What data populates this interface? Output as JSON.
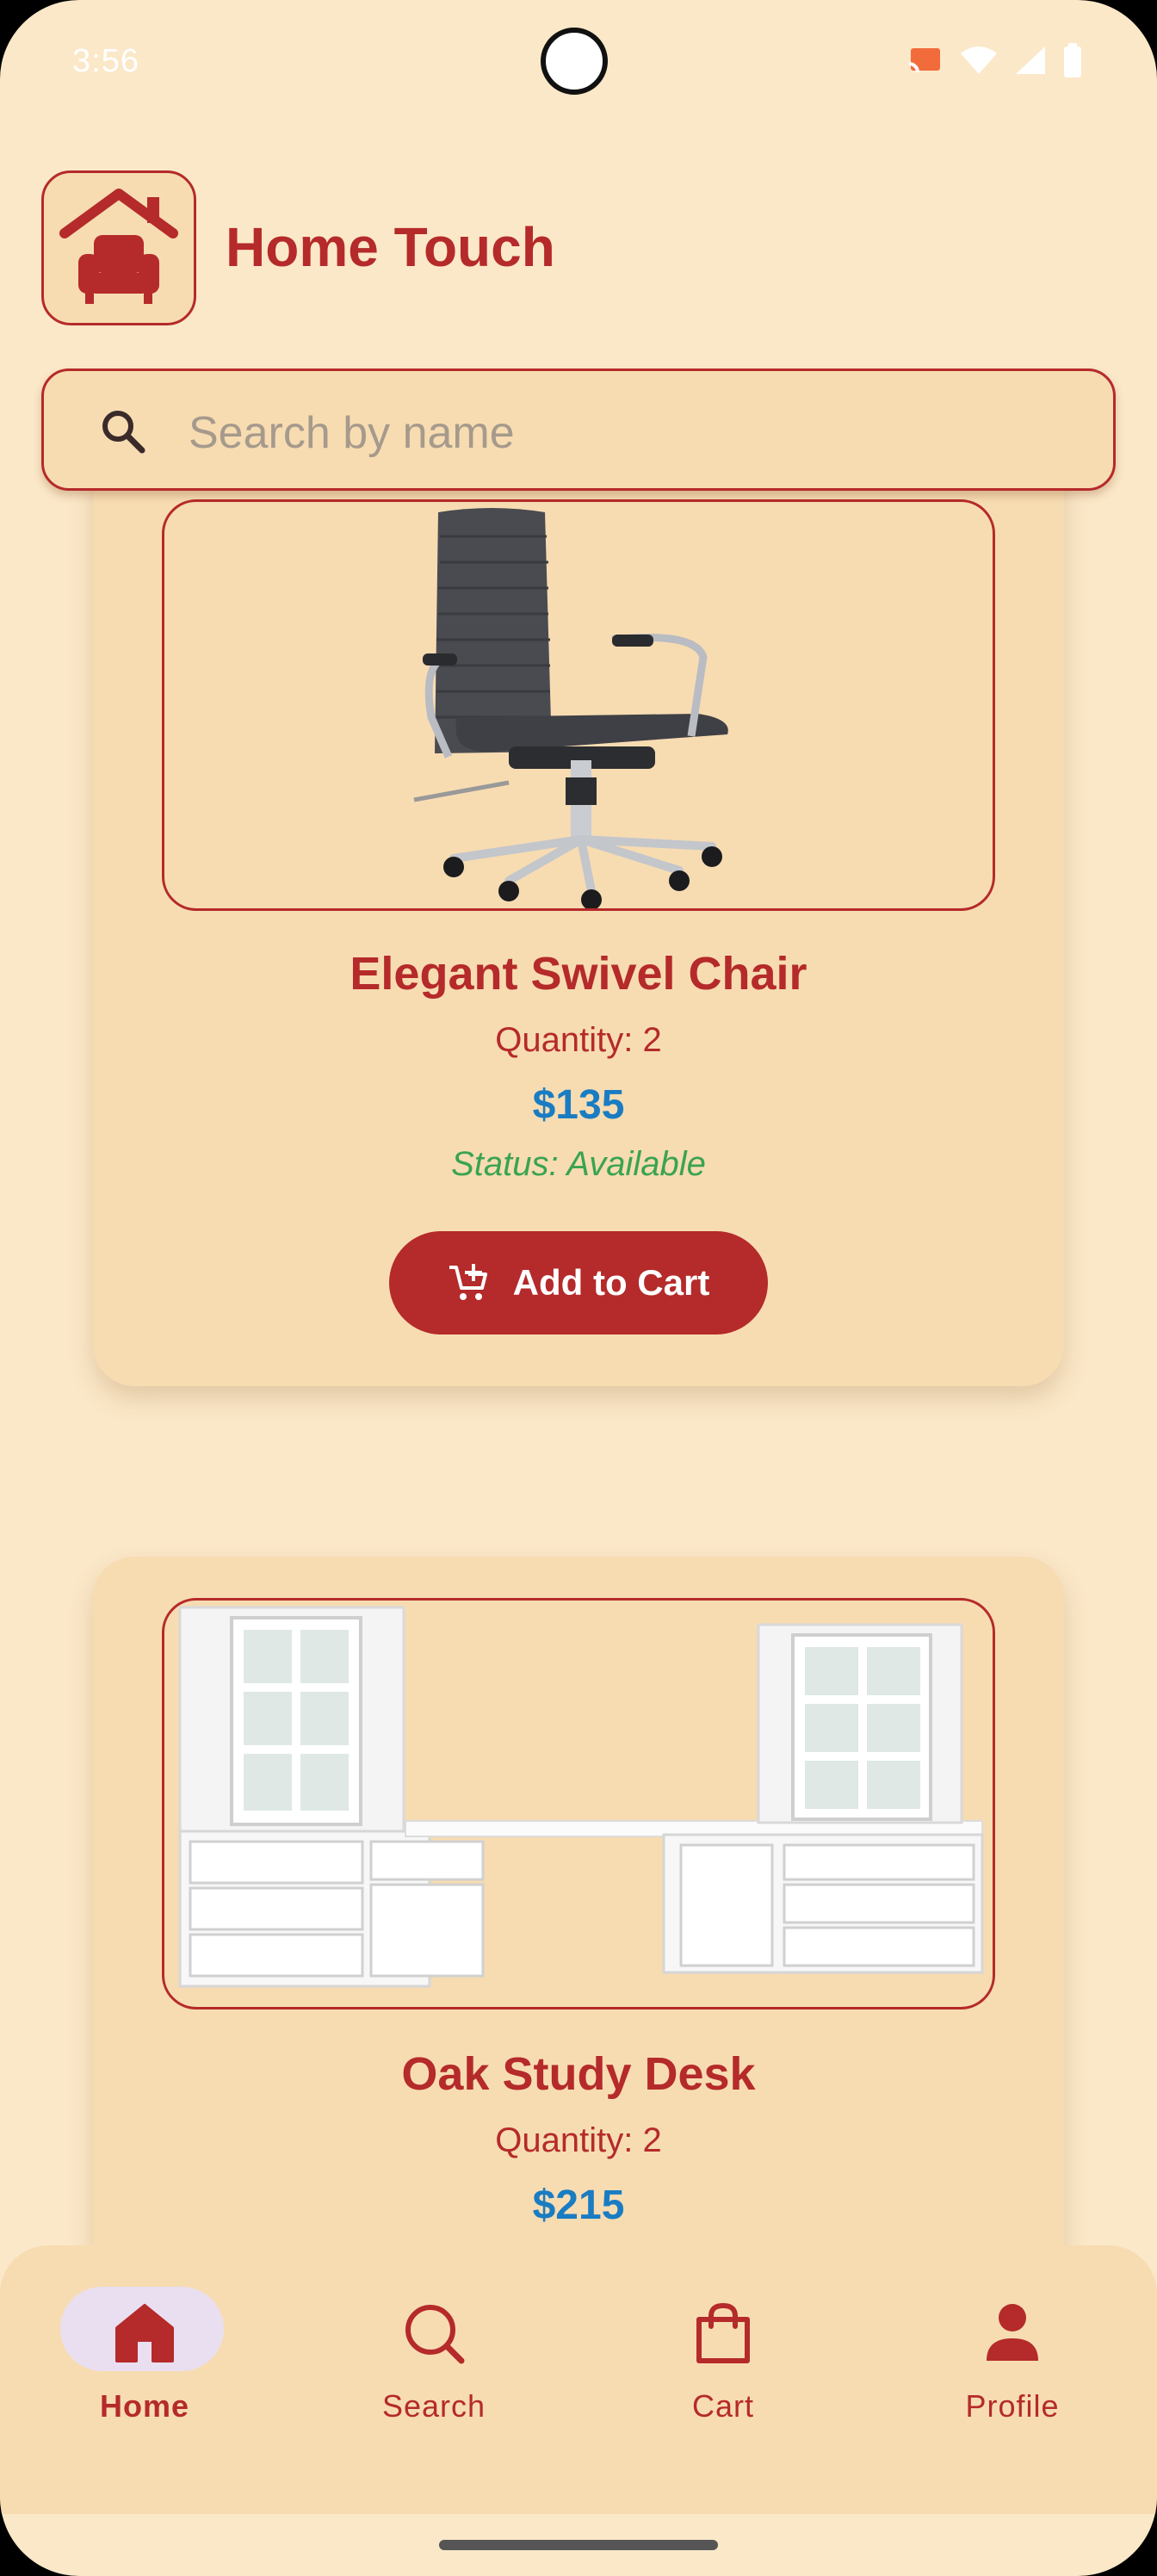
{
  "status_bar": {
    "time": "3:56"
  },
  "app": {
    "title": "Home Touch"
  },
  "search": {
    "placeholder": "Search by name"
  },
  "products": [
    {
      "name": "Elegant Swivel Chair",
      "quantity": "Quantity: 2",
      "price": "$135",
      "status": "Status: Available",
      "button_label": "Add to Cart",
      "image": "office-chair"
    },
    {
      "name": "Oak Study Desk",
      "quantity": "Quantity: 2",
      "price": "$215",
      "image": "white-desk-with-cabinets"
    }
  ],
  "bottom_nav": {
    "items": [
      {
        "label": "Home",
        "icon": "home-icon",
        "active": true
      },
      {
        "label": "Search",
        "icon": "search-icon",
        "active": false
      },
      {
        "label": "Cart",
        "icon": "bag-icon",
        "active": false
      },
      {
        "label": "Profile",
        "icon": "person-icon",
        "active": false
      }
    ]
  },
  "colors": {
    "primary": "#b52a2a",
    "background": "#fbe8c8",
    "surface": "#f7dcb2",
    "price": "#1a7cc2",
    "status_available": "#3aa351"
  }
}
